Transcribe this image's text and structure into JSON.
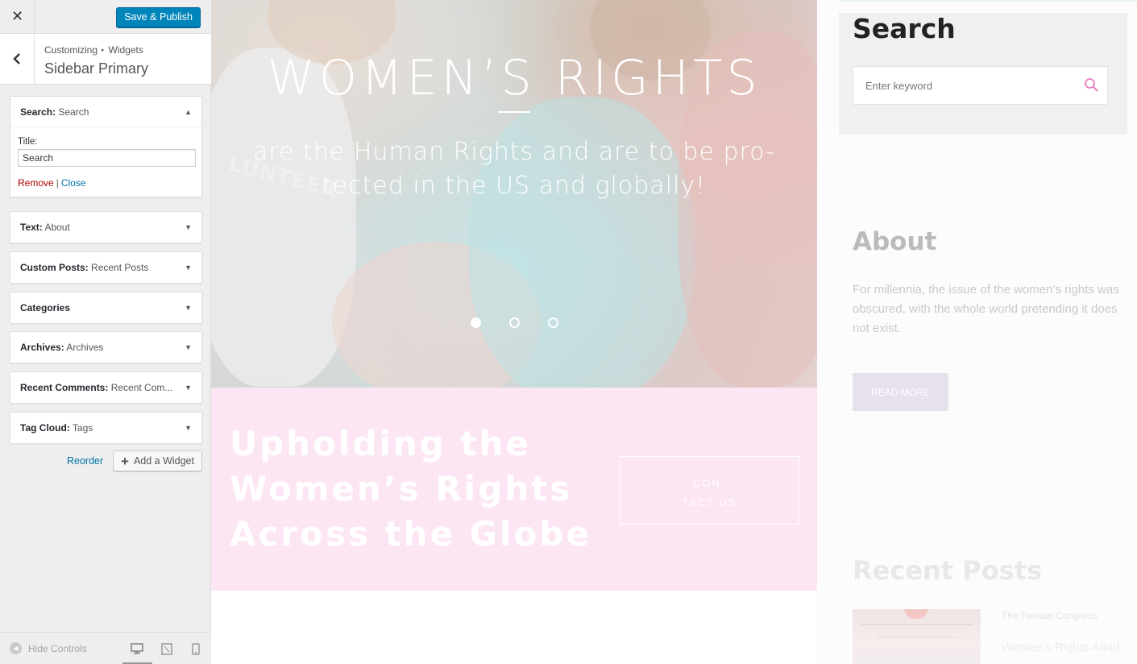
{
  "customizer": {
    "close_icon": "close-icon",
    "save_label": "Save & Publish",
    "breadcrumb": {
      "part1": "Customizing",
      "part2": "Widgets"
    },
    "section_title": "Sidebar Primary",
    "widgets": [
      {
        "name": "Search:",
        "instance": "Search",
        "open": true
      },
      {
        "name": "Text:",
        "instance": "About"
      },
      {
        "name": "Custom Posts:",
        "instance": "Recent Posts"
      },
      {
        "name": "Categories",
        "instance": ""
      },
      {
        "name": "Archives:",
        "instance": "Archives"
      },
      {
        "name": "Recent Comments:",
        "instance": "Recent Com..."
      },
      {
        "name": "Tag Cloud:",
        "instance": "Tags"
      }
    ],
    "search_form": {
      "title_label": "Title:",
      "title_value": "Search",
      "remove_label": "Remove",
      "divider": "|",
      "close_label": "Close"
    },
    "reorder_label": "Reorder",
    "add_widget_label": "Add a Widget",
    "hide_controls_label": "Hide Controls",
    "devices": [
      "desktop",
      "tablet",
      "mobile"
    ],
    "active_device": "desktop",
    "colors": {
      "primary": "#0085ba",
      "link": "#0073aa",
      "remove": "#aa0000"
    }
  },
  "preview": {
    "hero": {
      "title": "WOMEN’S RIGHTS",
      "subtitle_line1": "are the Human Rights and are to be pro-",
      "subtitle_line2": "tected in the US and globally!",
      "shirt_text": "LUNTEER",
      "slide_count": 3,
      "active_slide": 1
    },
    "cta": {
      "heading_line1": "Upholding the",
      "heading_line2": "Women’s Rights",
      "heading_line3": "Across the Globe",
      "button_line1": "CON-",
      "button_line2": "TACT US",
      "bg_color": "#fde6f4"
    },
    "sidebar": {
      "search_title": "Search",
      "search_placeholder": "Enter keyword",
      "about_title": "About",
      "about_text": "For millennia, the issue of the women’s rights was obscured, with the whole world pretending it does not exist.",
      "read_more": "READ MORE",
      "recent_posts_title": "Recent Posts",
      "post_meta": "The Female Congress",
      "post_title": "Women’s Rights Amid"
    }
  }
}
